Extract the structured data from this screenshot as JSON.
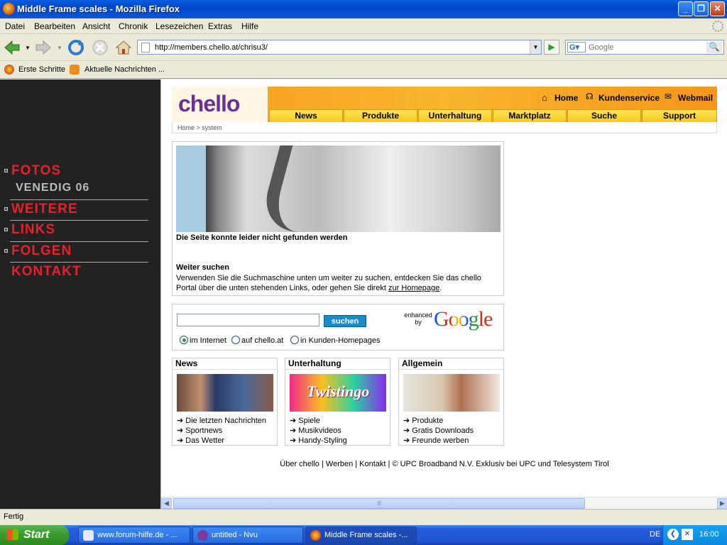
{
  "window": {
    "title": "Middle Frame scales - Mozilla Firefox"
  },
  "menu": [
    "Datei",
    "Bearbeiten",
    "Ansicht",
    "Chronik",
    "Lesezeichen",
    "Extras",
    "Hilfe"
  ],
  "navbar": {
    "url": "http://members.chello.at/chrisu3/",
    "search_placeholder": "Google"
  },
  "bookmarks": [
    "Erste Schritte",
    "Aktuelle Nachrichten ..."
  ],
  "left_nav": {
    "fotos": "FOTOS",
    "venedig": "VENEDIG 06",
    "weitere": "WEITERE",
    "links": "LINKS",
    "folgen": "FOLGEN",
    "kontakt": "KONTAKT"
  },
  "chello": {
    "logo": "chello",
    "top_links": [
      "Home",
      "Kundenservice",
      "Webmail"
    ],
    "tabs": [
      "News",
      "Produkte",
      "Unterhaltung",
      "Marktplatz",
      "Suche",
      "Support"
    ],
    "breadcrumb": "Home  >  system",
    "error_title": "Die Seite konnte leider nicht gefunden werden",
    "continue_title": "Weiter suchen",
    "continue_text": "Verwenden Sie die Suchmaschine unten um weiter zu suchen, entdecken Sie das chello Portal über die unten stehenden Links, oder gehen Sie direkt ",
    "homepage_link": "zur Homepage",
    "search_button": "suchen",
    "enhanced": "enhanced by",
    "google": "Google",
    "radios": [
      "im Internet",
      "auf chello.at",
      "in Kunden-Homepages"
    ],
    "boxes": [
      {
        "title": "News",
        "items": [
          "Die letzten Nachrichten",
          "Sportnews",
          "Das Wetter"
        ]
      },
      {
        "title": "Unterhaltung",
        "pic_text": "Twistingo",
        "items": [
          "Spiele",
          "Musikvideos",
          "Handy-Styling"
        ]
      },
      {
        "title": "Allgemein",
        "items": [
          "Produkte",
          "Gratis Downloads",
          "Freunde werben"
        ]
      }
    ],
    "footer": "Über chello | Werben | Kontakt | © UPC Broadband N.V. Exklusiv bei UPC und Telesystem Tirol"
  },
  "status": "Fertig",
  "taskbar": {
    "start": "Start",
    "tasks": [
      "www.forum-hilfe.de - ...",
      "untitled - Nvu",
      "Middle Frame scales -..."
    ],
    "lang": "DE",
    "time": "16:00"
  }
}
